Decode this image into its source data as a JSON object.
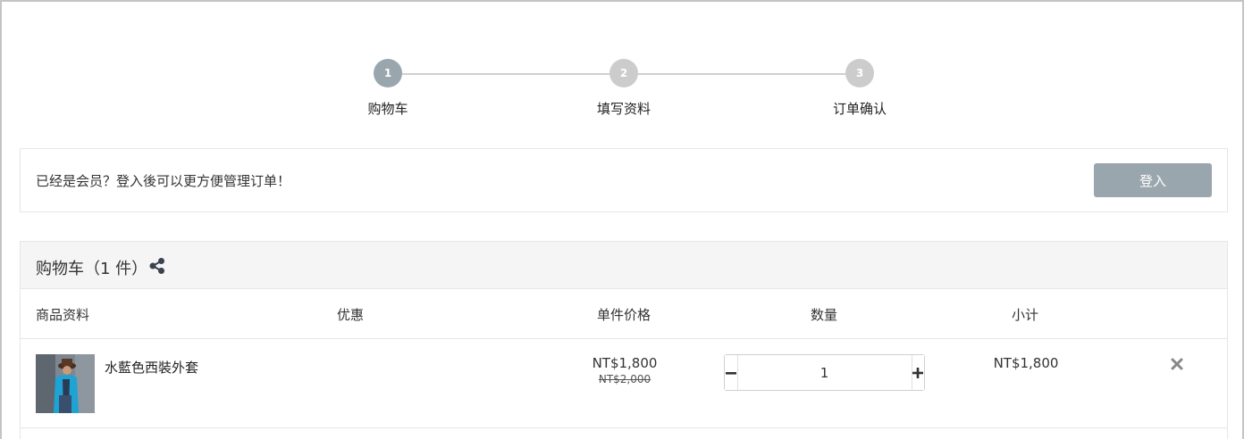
{
  "steps": [
    {
      "number": "1",
      "label": "购物车",
      "active": true
    },
    {
      "number": "2",
      "label": "填写资料",
      "active": false
    },
    {
      "number": "3",
      "label": "订单确认",
      "active": false
    }
  ],
  "login": {
    "message": "已经是会员？登入後可以更方便管理订单！",
    "button_label": "登入"
  },
  "cart": {
    "title": "购物车（1 件）",
    "share_icon": "share-icon",
    "columns": [
      "商品资料",
      "优惠",
      "单件价格",
      "数量",
      "小计"
    ],
    "items": [
      {
        "name": "水藍色西裝外套",
        "price": "NT$1,800",
        "original_price": "NT$2,000",
        "quantity": "1",
        "subtotal": "NT$1,800"
      }
    ]
  },
  "colors": {
    "accent": "#9aa6ad",
    "step_inactive": "#cccccc",
    "header_bg": "#f5f5f5",
    "border": "#e6e6e6"
  }
}
